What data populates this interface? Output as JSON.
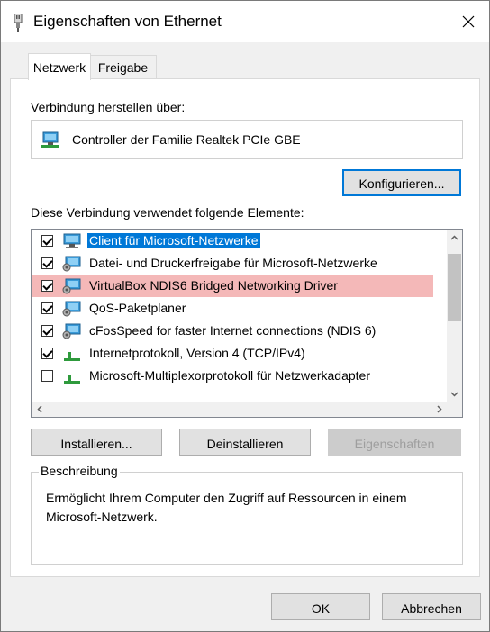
{
  "window": {
    "title": "Eigenschaften von Ethernet"
  },
  "tabs": [
    {
      "label": "Netzwerk"
    },
    {
      "label": "Freigabe"
    }
  ],
  "connect_label": "Verbindung herstellen über:",
  "adapter_name": "Controller der Familie Realtek PCIe GBE",
  "configure_button": "Konfigurieren...",
  "elements_label": "Diese Verbindung verwendet folgende Elemente:",
  "items": [
    {
      "label": "Client für Microsoft-Netzwerke",
      "checked": true,
      "icon": "network-client-icon"
    },
    {
      "label": "Datei- und Druckerfreigabe für Microsoft-Netzwerke",
      "checked": true,
      "icon": "network-service-icon"
    },
    {
      "label": "VirtualBox NDIS6 Bridged Networking Driver",
      "checked": true,
      "icon": "network-service-icon"
    },
    {
      "label": "QoS-Paketplaner",
      "checked": true,
      "icon": "network-service-icon"
    },
    {
      "label": "cFosSpeed for faster Internet connections (NDIS 6)",
      "checked": true,
      "icon": "network-service-icon"
    },
    {
      "label": "Internetprotokoll, Version 4 (TCP/IPv4)",
      "checked": true,
      "icon": "protocol-icon"
    },
    {
      "label": "Microsoft-Multiplexorprotokoll für Netzwerkadapter",
      "checked": false,
      "icon": "protocol-icon"
    }
  ],
  "buttons": {
    "install": "Installieren...",
    "uninstall": "Deinstallieren",
    "properties": "Eigenschaften",
    "ok": "OK",
    "cancel": "Abbrechen"
  },
  "description": {
    "legend": "Beschreibung",
    "text": "Ermöglicht Ihrem Computer den Zugriff auf Ressourcen in einem Microsoft-Netzwerk."
  },
  "colors": {
    "selection": "#0078d7",
    "highlight": "#f4b8b8",
    "focus": "#0078d7"
  }
}
